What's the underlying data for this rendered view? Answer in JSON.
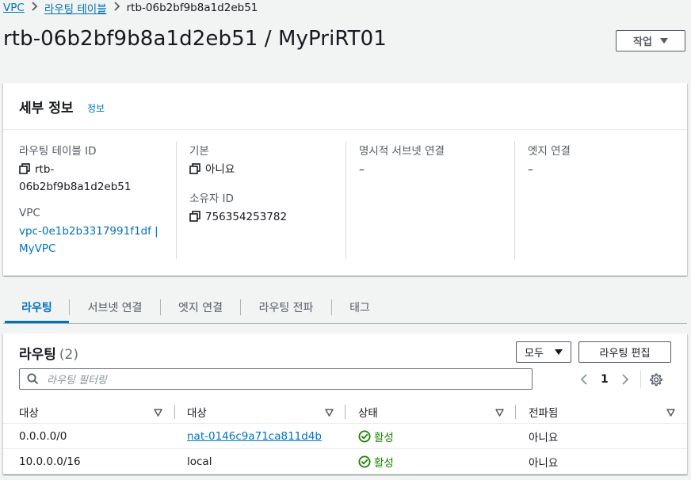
{
  "breadcrumb": {
    "items": [
      "VPC",
      "라우팅 테이블"
    ],
    "current": "rtb-06b2bf9b8a1d2eb51"
  },
  "page": {
    "title": "rtb-06b2bf9b8a1d2eb51 / MyPriRT01",
    "action_label": "작업"
  },
  "details": {
    "heading": "세부 정보",
    "info_link": "정보",
    "route_table_id_label": "라우팅 테이블 ID",
    "route_table_id_line1": "rtb-",
    "route_table_id_line2": "06b2bf9b8a1d2eb51",
    "vpc_label": "VPC",
    "vpc_line1": "vpc-0e1b2b3317991f1df |",
    "vpc_line2": "MyVPC",
    "main_label": "기본",
    "main_value": "아니요",
    "owner_label": "소유자 ID",
    "owner_value": "756354253782",
    "explicit_subnet_label": "명시적 서브넷 연결",
    "explicit_subnet_value": "–",
    "edge_label": "엣지 연결",
    "edge_value": "–"
  },
  "tabs": [
    "라우팅",
    "서브넷 연결",
    "엣지 연결",
    "라우팅 전파",
    "태그"
  ],
  "active_tab": "라우팅",
  "routes": {
    "title": "라우팅",
    "count": "(2)",
    "filter_select": "모두",
    "edit_button": "라우팅 편집",
    "search_placeholder": "라우팅 필터링",
    "page_number": "1",
    "columns": [
      "대상",
      "대상",
      "상태",
      "전파됨"
    ],
    "rows": [
      {
        "destination": "0.0.0.0/0",
        "target": "nat-0146c9a71ca811d4b",
        "target_is_link": true,
        "status": "활성",
        "propagated": "아니요"
      },
      {
        "destination": "10.0.0.0/16",
        "target": "local",
        "target_is_link": false,
        "status": "활성",
        "propagated": "아니요"
      }
    ]
  },
  "colors": {
    "link": "#0073bb",
    "success": "#1d8102",
    "text": "#16191f",
    "secondary": "#545b64",
    "background": "#f2f3f3"
  },
  "icons": [
    "chevron-right-icon",
    "caret-down-icon",
    "copy-icon",
    "search-icon",
    "chevron-left-icon",
    "settings-gear-icon",
    "sort-caret-icon",
    "status-success-icon"
  ]
}
